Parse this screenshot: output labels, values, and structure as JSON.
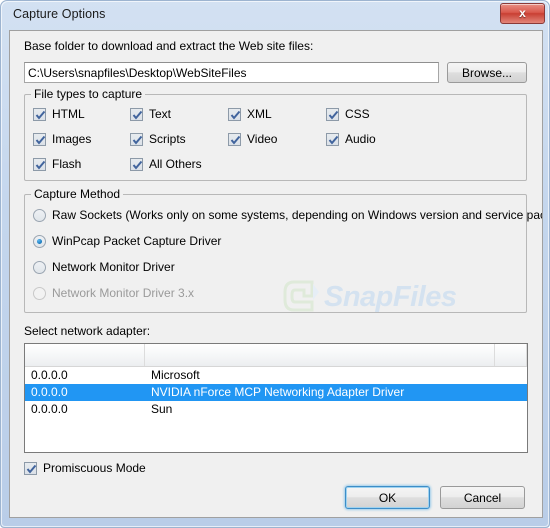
{
  "window": {
    "title": "Capture Options",
    "close_icon": "close-icon",
    "close_label": "x"
  },
  "base_folder": {
    "label": "Base folder to download and extract the Web site files:",
    "path_value": "C:\\Users\\snapfiles\\Desktop\\WebSiteFiles",
    "path_placeholder": "",
    "browse_label": "Browse..."
  },
  "file_types": {
    "group_title": "File types to capture",
    "items": [
      {
        "label": "HTML",
        "checked": true,
        "col": 0,
        "row": 0
      },
      {
        "label": "Text",
        "checked": true,
        "col": 1,
        "row": 0
      },
      {
        "label": "XML",
        "checked": true,
        "col": 2,
        "row": 0
      },
      {
        "label": "CSS",
        "checked": true,
        "col": 3,
        "row": 0
      },
      {
        "label": "Images",
        "checked": true,
        "col": 0,
        "row": 1
      },
      {
        "label": "Scripts",
        "checked": true,
        "col": 1,
        "row": 1
      },
      {
        "label": "Video",
        "checked": true,
        "col": 2,
        "row": 1
      },
      {
        "label": "Audio",
        "checked": true,
        "col": 3,
        "row": 1
      },
      {
        "label": "Flash",
        "checked": true,
        "col": 0,
        "row": 2
      },
      {
        "label": "All Others",
        "checked": true,
        "col": 1,
        "row": 2
      }
    ]
  },
  "capture_method": {
    "group_title": "Capture Method",
    "options": [
      {
        "label": "Raw Sockets  (Works only on some systems, depending on Windows version and service pack)",
        "selected": false,
        "disabled": false
      },
      {
        "label": "WinPcap Packet Capture Driver",
        "selected": true,
        "disabled": false
      },
      {
        "label": "Network Monitor Driver",
        "selected": false,
        "disabled": false
      },
      {
        "label": "Network Monitor Driver 3.x",
        "selected": false,
        "disabled": true
      }
    ]
  },
  "network_adapter": {
    "label": "Select network adapter:",
    "columns": [
      "",
      "",
      ""
    ],
    "rows": [
      {
        "address": "0.0.0.0",
        "name": "Microsoft",
        "selected": false
      },
      {
        "address": "0.0.0.0",
        "name": "NVIDIA nForce MCP Networking Adapter Driver",
        "selected": true
      },
      {
        "address": "0.0.0.0",
        "name": "Sun",
        "selected": false
      }
    ]
  },
  "promiscuous": {
    "label": "Promiscuous Mode",
    "checked": true
  },
  "buttons": {
    "ok_label": "OK",
    "cancel_label": "Cancel"
  },
  "watermark": {
    "text": "SnapFiles"
  },
  "colors": {
    "selection_blue": "#2196f3",
    "close_red": "#c83f33",
    "accent_focus": "#3c8dc8",
    "check_blue": "#41649d",
    "watermark_blue": "#d4e2f0"
  }
}
